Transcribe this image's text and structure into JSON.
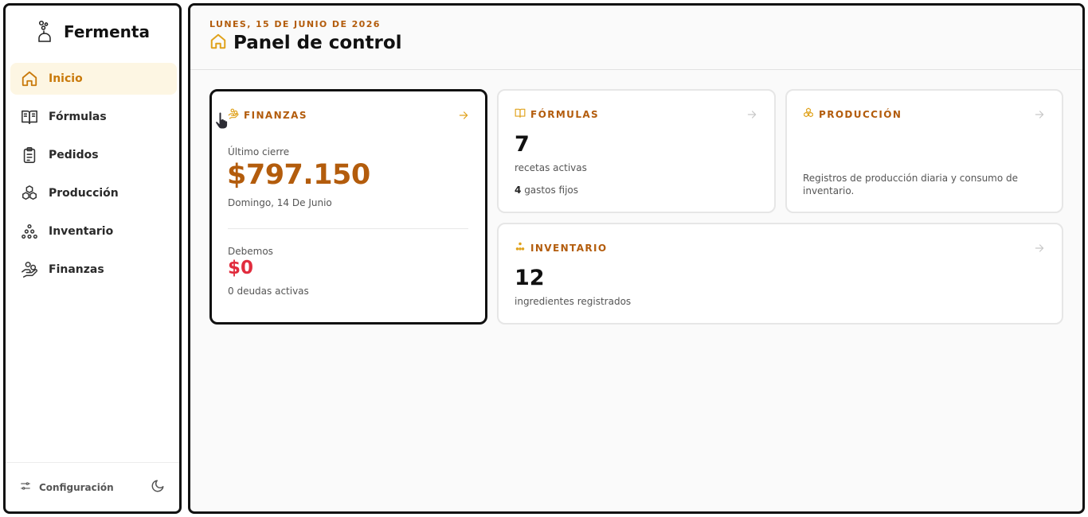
{
  "app": {
    "name": "Fermenta"
  },
  "sidebar": {
    "items": [
      {
        "label": "Inicio",
        "icon": "home-icon",
        "active": true
      },
      {
        "label": "Fórmulas",
        "icon": "book-open-icon",
        "active": false
      },
      {
        "label": "Pedidos",
        "icon": "clipboard-list-icon",
        "active": false
      },
      {
        "label": "Producción",
        "icon": "boxes-icon",
        "active": false
      },
      {
        "label": "Inventario",
        "icon": "dots-pyramid-icon",
        "active": false
      },
      {
        "label": "Finanzas",
        "icon": "hand-coins-icon",
        "active": false
      }
    ],
    "footer": {
      "settings_label": "Configuración",
      "settings_icon": "sliders-icon",
      "theme_icon": "moon-icon"
    }
  },
  "header": {
    "date": "LUNES, 15 DE JUNIO DE 2026",
    "title": "Panel de control",
    "title_icon": "home-icon"
  },
  "cards": {
    "finanzas": {
      "title": "FINANZAS",
      "last_close_label": "Último cierre",
      "last_close_amount": "$797.150",
      "last_close_date": "Domingo, 14 De Junio",
      "debt_label": "Debemos",
      "debt_amount": "$0",
      "debt_count": "0 deudas activas"
    },
    "formulas": {
      "title": "FÓRMULAS",
      "count": "7",
      "count_label": "recetas activas",
      "fixed_count": "4",
      "fixed_label": "gastos fijos"
    },
    "produccion": {
      "title": "PRODUCCIÓN",
      "description": "Registros de producción diaria y consumo de inventario."
    },
    "inventario": {
      "title": "INVENTARIO",
      "count": "12",
      "count_label": "ingredientes registrados"
    }
  },
  "colors": {
    "accent": "#c97a0b",
    "accent_dark": "#b35c0c",
    "danger": "#e12c3d",
    "active_bg": "#fdf6e3"
  }
}
